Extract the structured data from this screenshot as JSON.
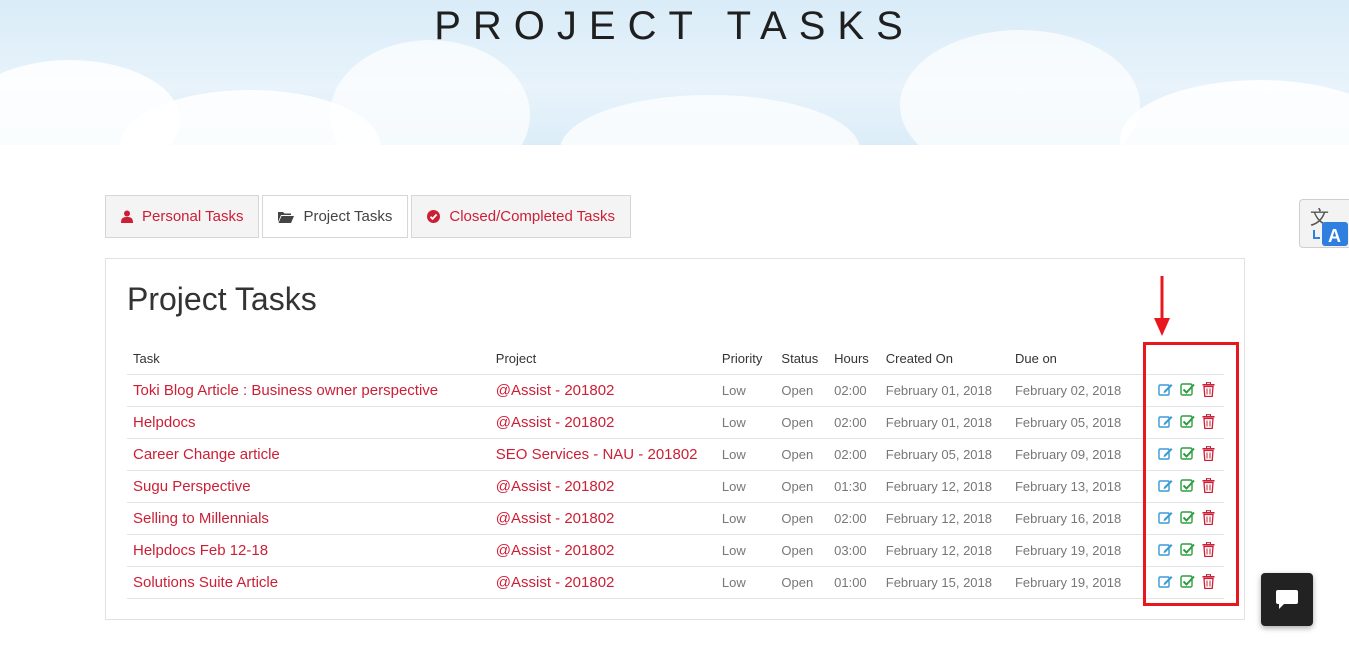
{
  "hero": {
    "title": "PROJECT TASKS"
  },
  "tabs": [
    {
      "label": "Personal Tasks",
      "icon": "user-icon",
      "active": false
    },
    {
      "label": "Project Tasks",
      "icon": "folder-open-icon",
      "active": true
    },
    {
      "label": "Closed/Completed Tasks",
      "icon": "check-circle-icon",
      "active": false
    }
  ],
  "panel": {
    "title": "Project Tasks",
    "columns": [
      "Task",
      "Project",
      "Priority",
      "Status",
      "Hours",
      "Created On",
      "Due on"
    ],
    "rows": [
      {
        "task": "Toki Blog Article : Business owner perspective",
        "project": "@Assist - 201802",
        "priority": "Low",
        "status": "Open",
        "hours": "02:00",
        "created": "February 01, 2018",
        "due": "February 02, 2018"
      },
      {
        "task": "Helpdocs",
        "project": "@Assist - 201802",
        "priority": "Low",
        "status": "Open",
        "hours": "02:00",
        "created": "February 01, 2018",
        "due": "February 05, 2018"
      },
      {
        "task": "Career Change article",
        "project": "SEO Services - NAU - 201802",
        "priority": "Low",
        "status": "Open",
        "hours": "02:00",
        "created": "February 05, 2018",
        "due": "February 09, 2018"
      },
      {
        "task": "Sugu Perspective",
        "project": "@Assist - 201802",
        "priority": "Low",
        "status": "Open",
        "hours": "01:30",
        "created": "February 12, 2018",
        "due": "February 13, 2018"
      },
      {
        "task": "Selling to Millennials",
        "project": "@Assist - 201802",
        "priority": "Low",
        "status": "Open",
        "hours": "02:00",
        "created": "February 12, 2018",
        "due": "February 16, 2018"
      },
      {
        "task": "Helpdocs Feb 12-18",
        "project": "@Assist - 201802",
        "priority": "Low",
        "status": "Open",
        "hours": "03:00",
        "created": "February 12, 2018",
        "due": "February 19, 2018"
      },
      {
        "task": "Solutions Suite Article",
        "project": "@Assist - 201802",
        "priority": "Low",
        "status": "Open",
        "hours": "01:00",
        "created": "February 15, 2018",
        "due": "February 19, 2018"
      }
    ],
    "row_actions": [
      "edit-icon",
      "complete-check-icon",
      "delete-trash-icon"
    ]
  },
  "colors": {
    "accent_red": "#cc1f36",
    "edit_blue": "#3a9bd5",
    "check_green": "#2e9d3e",
    "annotation_red": "#e8171e"
  },
  "widgets": {
    "translate_icon": "google-translate-icon",
    "chat_icon": "chat-bubble-icon"
  }
}
